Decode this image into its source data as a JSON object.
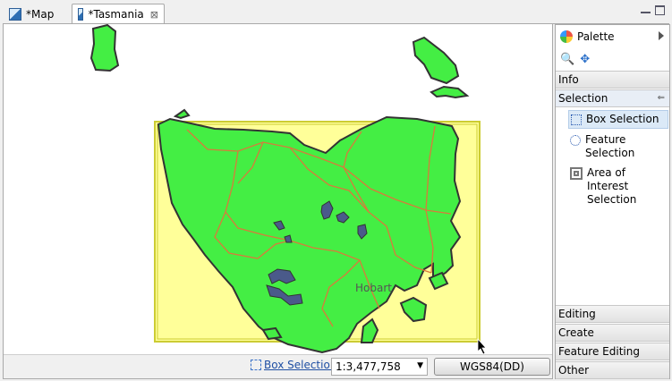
{
  "tabs": [
    {
      "label": "*Map",
      "icon": "map-icon",
      "active": false
    },
    {
      "label": "*Tasmania",
      "icon": "map-icon",
      "active": true,
      "close_icon": "close-icon"
    }
  ],
  "window_controls": {
    "minimize": "minimize-icon",
    "maximize": "maximize-icon"
  },
  "map": {
    "city_label": "Hobart",
    "colors": {
      "land": "#44ee44",
      "coast": "#333333",
      "roads": "#d97a3c",
      "lakes": "#4a5a8a",
      "selection_fill": "#ffff99",
      "selection_border": "#cccc33"
    }
  },
  "statusbar": {
    "tool_label": "Box Selection",
    "scale": "1:3,477,758",
    "crs": "WGS84(DD)"
  },
  "palette": {
    "title": "Palette",
    "tools": [
      "zoom-icon",
      "pan-icon"
    ],
    "drawers_top": [
      {
        "label": "Info",
        "expanded": false
      },
      {
        "label": "Selection",
        "expanded": true
      }
    ],
    "selection_entries": [
      {
        "label": "Box Selection",
        "selected": true,
        "icon": "box-selection-icon"
      },
      {
        "label": "Feature Selection",
        "selected": false,
        "icon": "feature-selection-icon"
      },
      {
        "label": "Area of Interest Selection",
        "selected": false,
        "icon": "area-of-interest-icon"
      }
    ],
    "drawers_bottom": [
      {
        "label": "Editing"
      },
      {
        "label": "Create"
      },
      {
        "label": "Feature Editing"
      },
      {
        "label": "Other"
      }
    ]
  }
}
